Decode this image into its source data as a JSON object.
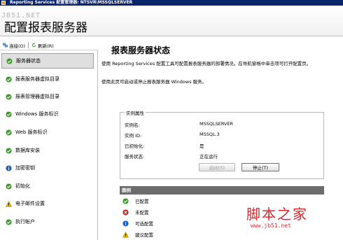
{
  "window": {
    "title": "Reporting Services 配置管理器: NTSVR\\MSSQLSERVER"
  },
  "watermark_top": "JB51.NET",
  "header": {
    "title": "配置报表服务器"
  },
  "toolbar": {
    "connect_label": "连接(O)",
    "refresh_label": "刷新(R)"
  },
  "sidebar": {
    "items": [
      {
        "label": "服务器状态",
        "status": "configured"
      },
      {
        "label": "报表服务器虚拟目录",
        "status": "configured"
      },
      {
        "label": "报表管理器虚拟目录",
        "status": "configured"
      },
      {
        "label": "Windows 服务标识",
        "status": "configured"
      },
      {
        "label": "Web 服务标识",
        "status": "configured"
      },
      {
        "label": "数据库安装",
        "status": "configured"
      },
      {
        "label": "加密密钥",
        "status": "optional"
      },
      {
        "label": "初始化",
        "status": "configured"
      },
      {
        "label": "电子邮件设置",
        "status": "recommended"
      },
      {
        "label": "执行帐户",
        "status": "configured"
      }
    ]
  },
  "main": {
    "title": "报表服务器状态",
    "desc1": "使用 Reporting Services 配置工具可配置报表服务器的部署情况。在导航窗格中单击项可打开配置页。",
    "desc2": "使用此页可启动或停止报表服务器 Windows 服务。",
    "instance": {
      "group_title": "实例属性",
      "labels": [
        "实例名:",
        "实例 ID:",
        "已初始化:",
        "服务状态:"
      ],
      "values": [
        "MSSQLSERVER",
        "MSSQL.3",
        "是",
        "正在运行"
      ],
      "start_button": "启动(S)",
      "stop_button": "停止(T)"
    },
    "legend": {
      "title": "图例",
      "items": [
        {
          "label": "已配置",
          "status": "configured"
        },
        {
          "label": "未配置",
          "status": "not-configured"
        },
        {
          "label": "可选配置",
          "status": "optional"
        },
        {
          "label": "建议配置",
          "status": "recommended"
        }
      ]
    }
  },
  "watermark": {
    "brand": "脚本之家",
    "url": "www.jb51.net"
  },
  "colors": {
    "titlebar": "#0a246a",
    "configured": "#3a9a2a",
    "not_configured": "#c81e1e",
    "optional": "#1f5bc4",
    "recommended": "#e6b800",
    "watermark": "#d8272d"
  }
}
